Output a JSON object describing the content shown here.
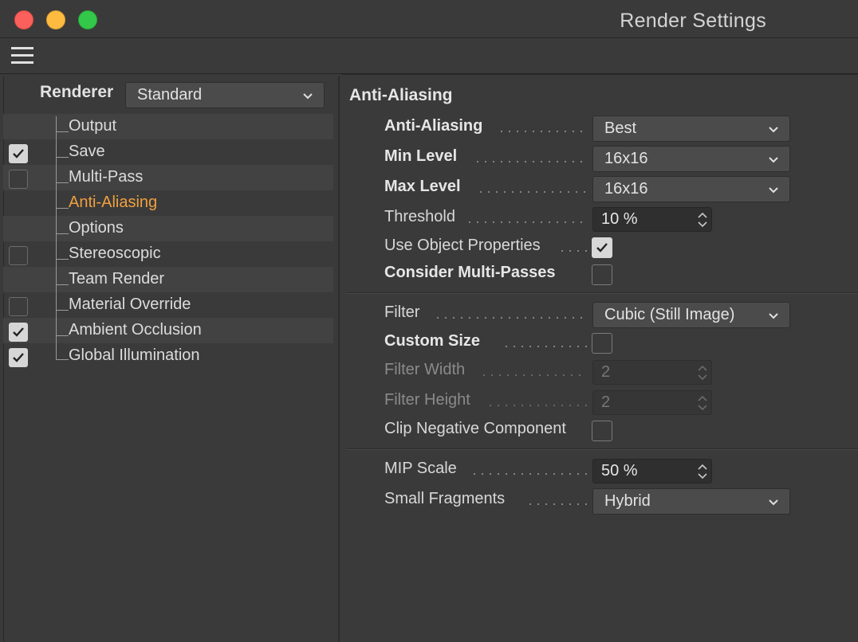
{
  "window": {
    "title": "Render Settings"
  },
  "left_panel": {
    "renderer_label": "Renderer",
    "renderer_value": "Standard",
    "tree": [
      {
        "label": "Output",
        "checkbox": "none",
        "active": false
      },
      {
        "label": "Save",
        "checkbox": "checked",
        "active": false
      },
      {
        "label": "Multi-Pass",
        "checkbox": "unchecked",
        "active": false
      },
      {
        "label": "Anti-Aliasing",
        "checkbox": "none",
        "active": true
      },
      {
        "label": "Options",
        "checkbox": "none",
        "active": false
      },
      {
        "label": "Stereoscopic",
        "checkbox": "unchecked",
        "active": false
      },
      {
        "label": "Team Render",
        "checkbox": "none",
        "active": false
      },
      {
        "label": "Material Override",
        "checkbox": "unchecked",
        "active": false
      },
      {
        "label": "Ambient Occlusion",
        "checkbox": "checked",
        "active": false
      },
      {
        "label": "Global Illumination",
        "checkbox": "checked",
        "active": false
      }
    ]
  },
  "right_panel": {
    "section_title": "Anti-Aliasing",
    "anti_aliasing": {
      "label": "Anti-Aliasing",
      "value": "Best"
    },
    "min_level": {
      "label": "Min Level",
      "value": "16x16"
    },
    "max_level": {
      "label": "Max Level",
      "value": "16x16"
    },
    "threshold": {
      "label": "Threshold",
      "value": "10 %"
    },
    "use_object_properties": {
      "label": "Use Object Properties",
      "checked": true
    },
    "consider_multi_passes": {
      "label": "Consider Multi-Passes",
      "checked": false
    },
    "filter": {
      "label": "Filter",
      "value": "Cubic (Still Image)"
    },
    "custom_size": {
      "label": "Custom Size",
      "checked": false
    },
    "filter_width": {
      "label": "Filter Width",
      "value": "2"
    },
    "filter_height": {
      "label": "Filter Height",
      "value": "2"
    },
    "clip_negative": {
      "label": "Clip Negative Component",
      "checked": false
    },
    "mip_scale": {
      "label": "MIP Scale",
      "value": "50 %"
    },
    "small_fragments": {
      "label": "Small Fragments",
      "value": "Hybrid"
    }
  },
  "colors": {
    "background": "#3a3a3a",
    "active_item": "#f0a040",
    "close": "#fc605c",
    "minimize": "#fdbc40",
    "maximize": "#34c84a"
  }
}
